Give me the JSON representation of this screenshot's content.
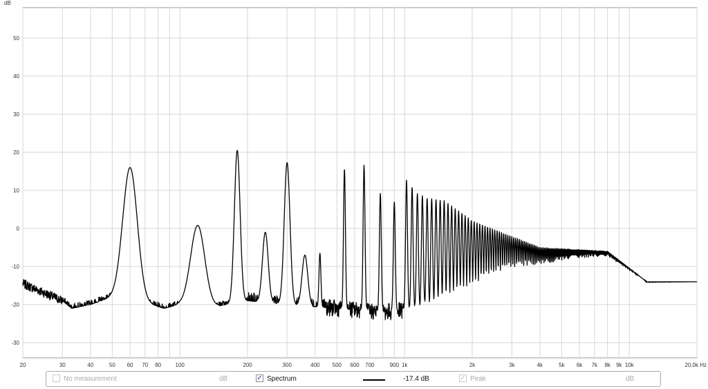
{
  "chart_data": {
    "type": "line",
    "title": "",
    "ylabel": "dB",
    "x_unit_label": "20.0k Hz",
    "x_scale": "log",
    "xlim": [
      20,
      20000
    ],
    "ylim": [
      -34,
      58
    ],
    "grid": true,
    "y_ticks": [
      -30,
      -20,
      -10,
      0,
      10,
      20,
      30,
      40,
      50
    ],
    "y_tick_labels": [
      "-30",
      "-20",
      "-10",
      "0",
      "10",
      "20",
      "30",
      "40",
      "50"
    ],
    "x_ticks": [
      20,
      30,
      40,
      50,
      60,
      70,
      80,
      100,
      200,
      300,
      400,
      500,
      600,
      700,
      900,
      1000,
      2000,
      3000,
      4000,
      5000,
      6000,
      7000,
      8000,
      9000,
      10000,
      20000
    ],
    "x_tick_labels": [
      "20",
      "30",
      "40",
      "50",
      "60",
      "70",
      "80",
      "100",
      "200",
      "300",
      "400",
      "500",
      "600",
      "700",
      "900",
      "1k",
      "2k",
      "3k",
      "4k",
      "5k",
      "6k",
      "7k",
      "8k",
      "9k",
      "10k",
      "20.0k Hz"
    ],
    "series": [
      {
        "name": "Spectrum",
        "color": "#000000",
        "noise_floor": [
          [
            20,
            -14.5
          ],
          [
            25,
            -17
          ],
          [
            30,
            -19
          ],
          [
            33,
            -21
          ],
          [
            40,
            -20
          ],
          [
            50,
            -18
          ],
          [
            55,
            -17
          ],
          [
            70,
            -19.5
          ],
          [
            85,
            -21
          ],
          [
            100,
            -20
          ],
          [
            130,
            -21
          ],
          [
            200,
            -19
          ],
          [
            300,
            -20
          ],
          [
            500,
            -21
          ],
          [
            800,
            -22
          ],
          [
            1000,
            -21.5
          ],
          [
            1500,
            -21
          ],
          [
            2000,
            -22
          ],
          [
            4000,
            -23
          ],
          [
            8000,
            -24
          ],
          [
            12000,
            -22
          ],
          [
            20000,
            -18
          ]
        ],
        "peaks": [
          {
            "x": 60,
            "y": 16
          },
          {
            "x": 100,
            "y": -10.5
          },
          {
            "x": 120,
            "y": 0.8
          },
          {
            "x": 180,
            "y": 20.5
          },
          {
            "x": 240,
            "y": -1
          },
          {
            "x": 300,
            "y": 17.3
          },
          {
            "x": 360,
            "y": -7
          },
          {
            "x": 420,
            "y": -6.5
          },
          {
            "x": 540,
            "y": 15.7
          },
          {
            "x": 660,
            "y": 16.6
          },
          {
            "x": 780,
            "y": 9.2
          },
          {
            "x": 900,
            "y": 7
          },
          {
            "x": 1020,
            "y": 12.7
          },
          {
            "x": 1140,
            "y": 9.2
          },
          {
            "x": 1260,
            "y": 8
          },
          {
            "x": 1500,
            "y": 7.3
          },
          {
            "x": 1800,
            "y": 4
          },
          {
            "x": 2000,
            "y": 2
          },
          {
            "x": 4000,
            "y": -5
          },
          {
            "x": 8000,
            "y": -6
          },
          {
            "x": 12000,
            "y": -14
          }
        ]
      }
    ]
  },
  "legend": {
    "no_measurement_label": "No measurement",
    "no_measurement_unit": "dB",
    "spectrum_label": "Spectrum",
    "spectrum_value": "-17.4 dB",
    "peak_label": "Peak",
    "peak_unit": "dB",
    "check_mark": "✓"
  }
}
